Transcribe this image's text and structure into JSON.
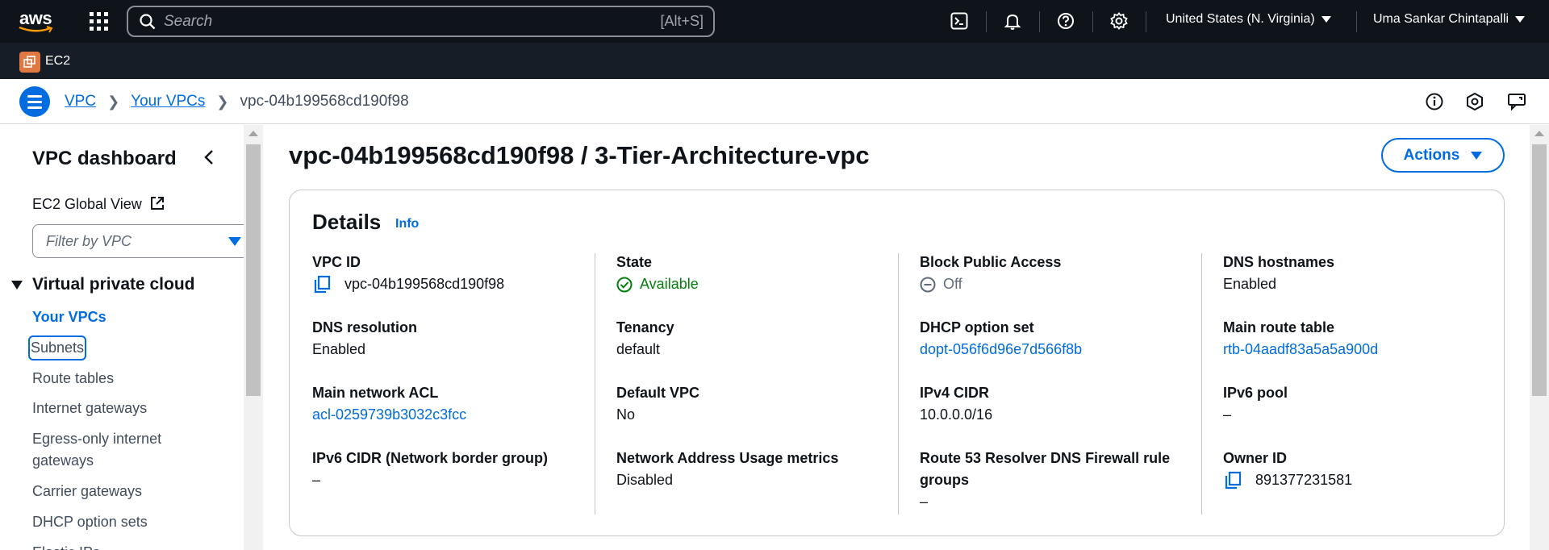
{
  "topnav": {
    "logo": "aws",
    "search_placeholder": "Search",
    "search_shortcut": "[Alt+S]",
    "region": "United States (N. Virginia)",
    "user": "Uma Sankar Chintapalli"
  },
  "servicebar": {
    "label": "EC2"
  },
  "breadcrumb": {
    "items": [
      "VPC",
      "Your VPCs"
    ],
    "current": "vpc-04b199568cd190f98"
  },
  "sidebar": {
    "title": "VPC dashboard",
    "global_view": "EC2 Global View",
    "filter_placeholder": "Filter by VPC",
    "section": "Virtual private cloud",
    "items": [
      "Your VPCs",
      "Subnets",
      "Route tables",
      "Internet gateways",
      "Egress-only internet gateways",
      "Carrier gateways",
      "DHCP option sets",
      "Elastic IPs"
    ]
  },
  "main": {
    "title": "vpc-04b199568cd190f98 / 3-Tier-Architecture-vpc",
    "actions_label": "Actions",
    "details": {
      "heading": "Details",
      "info": "Info",
      "fields": [
        {
          "label": "VPC ID",
          "value": "vpc-04b199568cd190f98"
        },
        {
          "label": "State",
          "value": "Available"
        },
        {
          "label": "Block Public Access",
          "value": "Off"
        },
        {
          "label": "DNS hostnames",
          "value": "Enabled"
        },
        {
          "label": "DNS resolution",
          "value": "Enabled"
        },
        {
          "label": "Tenancy",
          "value": "default"
        },
        {
          "label": "DHCP option set",
          "value": "dopt-056f6d96e7d566f8b"
        },
        {
          "label": "Main route table",
          "value": "rtb-04aadf83a5a5a900d"
        },
        {
          "label": "Main network ACL",
          "value": "acl-0259739b3032c3fcc"
        },
        {
          "label": "Default VPC",
          "value": "No"
        },
        {
          "label": "IPv4 CIDR",
          "value": "10.0.0.0/16"
        },
        {
          "label": "IPv6 pool",
          "value": "–"
        },
        {
          "label": "IPv6 CIDR (Network border group)",
          "value": "–"
        },
        {
          "label": "Network Address Usage metrics",
          "value": "Disabled"
        },
        {
          "label": "Route 53 Resolver DNS Firewall rule groups",
          "value": "–"
        },
        {
          "label": "Owner ID",
          "value": "891377231581"
        }
      ]
    }
  },
  "colors": {
    "topnav_bg": "#0f141a",
    "link": "#006ce0",
    "success": "#037f0c",
    "service_icon": "#e07941"
  }
}
